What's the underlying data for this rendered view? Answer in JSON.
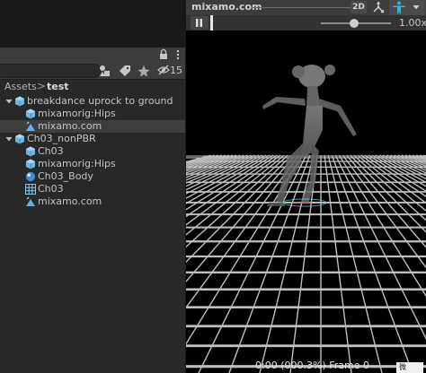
{
  "project": {
    "hidden_count": "15",
    "search": {
      "value": "",
      "placeholder": ""
    },
    "breadcrumb": {
      "root": "Assets",
      "separator": ">",
      "current": "test"
    },
    "tree": [
      {
        "label": "breakdance uprock to ground",
        "icon": "prefab-icon",
        "expanded": true
      },
      {
        "label": "mixamorig:Hips",
        "icon": "prefab-icon"
      },
      {
        "label": "mixamo.com",
        "icon": "animation-clip-icon",
        "selected": true
      },
      {
        "label": "Ch03_nonPBR",
        "icon": "prefab-icon",
        "expanded": true
      },
      {
        "label": "Ch03",
        "icon": "prefab-icon"
      },
      {
        "label": "mixamorig:Hips",
        "icon": "prefab-icon"
      },
      {
        "label": "Ch03_Body",
        "icon": "material-sphere-icon"
      },
      {
        "label": "Ch03",
        "icon": "mesh-grid-icon"
      },
      {
        "label": "mixamo.com",
        "icon": "animation-clip-icon"
      }
    ]
  },
  "preview": {
    "title": "mixamo.com",
    "mode_2d": "2D",
    "speed": "1.00x",
    "status": "0:00 (000.3%) Frame 0",
    "corner_badge": "微"
  },
  "colors": {
    "panel": "#282828",
    "toolbar": "#3c3c3c",
    "selected_row": "#3e3e3e",
    "accent_blue": "#55b4ff",
    "prefab_icon": "#6fb8e6"
  }
}
